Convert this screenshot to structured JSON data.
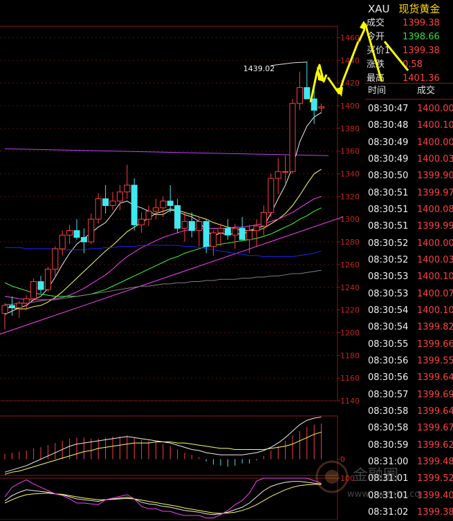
{
  "quote": {
    "symbol": "XAU",
    "name": "现货黄金",
    "rows": [
      {
        "label": "成交",
        "value": "1399.38",
        "color": "#ff4040"
      },
      {
        "label": "今开",
        "value": "1398.66",
        "color": "#30e030"
      },
      {
        "label": "买价1",
        "value": "1399.38",
        "color": "#ff4040"
      },
      {
        "label": "涨跌",
        "value": "0.58",
        "color": "#ff4040"
      },
      {
        "label": "最高",
        "value": "1401.36",
        "color": "#ff4040"
      }
    ]
  },
  "ticks": {
    "header_time": "时间",
    "header_price": "成交",
    "rows": [
      {
        "time": "08:30:47",
        "price": "1400.00"
      },
      {
        "time": "08:30:48",
        "price": "1400.10"
      },
      {
        "time": "08:30:49",
        "price": "1400.00"
      },
      {
        "time": "08:30:49",
        "price": "1400.03"
      },
      {
        "time": "08:30:50",
        "price": "1399.90"
      },
      {
        "time": "08:30:51",
        "price": "1399.97"
      },
      {
        "time": "08:30:51",
        "price": "1400.08"
      },
      {
        "time": "08:30:51",
        "price": "1399.99"
      },
      {
        "time": "08:30:52",
        "price": "1400.00"
      },
      {
        "time": "08:30:52",
        "price": "1400.03"
      },
      {
        "time": "08:30:53",
        "price": "1400.10"
      },
      {
        "time": "08:30:53",
        "price": "1400.07"
      },
      {
        "time": "08:30:54",
        "price": "1400.10"
      },
      {
        "time": "08:30:54",
        "price": "1399.82"
      },
      {
        "time": "08:30:55",
        "price": "1399.66"
      },
      {
        "time": "08:30:56",
        "price": "1399.55"
      },
      {
        "time": "08:30:56",
        "price": "1399.64"
      },
      {
        "time": "08:30:57",
        "price": "1399.69"
      },
      {
        "time": "08:30:58",
        "price": "1399.64"
      },
      {
        "time": "08:30:58",
        "price": "1399.67"
      },
      {
        "time": "08:30:59",
        "price": "1399.62"
      },
      {
        "time": "08:31:00",
        "price": "1399.48"
      },
      {
        "time": "08:31:01",
        "price": "1399.52"
      },
      {
        "time": "08:31:01",
        "price": "1399.40"
      },
      {
        "time": "08:31:02",
        "price": "1399.38"
      }
    ]
  },
  "watermark": {
    "text": "金融圈",
    "url": "www.jrwenku.com"
  },
  "chart_data": [
    {
      "type": "candlestick",
      "ylim": [
        1140,
        1470
      ],
      "yticks": [
        1140,
        1160,
        1180,
        1200,
        1220,
        1240,
        1260,
        1280,
        1300,
        1320,
        1340,
        1360,
        1380,
        1400,
        1420,
        1440,
        1460
      ],
      "annotation": "1439.02",
      "up_color": "#ff4040",
      "down_color": "#40e8f0",
      "candles": [
        [
          1217,
          1226,
          1203,
          1224
        ],
        [
          1224,
          1232,
          1215,
          1222
        ],
        [
          1222,
          1228,
          1213,
          1226
        ],
        [
          1226,
          1233,
          1220,
          1230
        ],
        [
          1230,
          1248,
          1228,
          1245
        ],
        [
          1245,
          1250,
          1235,
          1238
        ],
        [
          1238,
          1258,
          1236,
          1256
        ],
        [
          1256,
          1276,
          1250,
          1274
        ],
        [
          1274,
          1290,
          1268,
          1286
        ],
        [
          1286,
          1295,
          1278,
          1290
        ],
        [
          1290,
          1300,
          1282,
          1284
        ],
        [
          1284,
          1292,
          1270,
          1280
        ],
        [
          1280,
          1305,
          1278,
          1300
        ],
        [
          1300,
          1323,
          1296,
          1318
        ],
        [
          1318,
          1330,
          1305,
          1312
        ],
        [
          1312,
          1324,
          1308,
          1316
        ],
        [
          1316,
          1330,
          1308,
          1324
        ],
        [
          1324,
          1348,
          1318,
          1330
        ],
        [
          1330,
          1336,
          1290,
          1295
        ],
        [
          1295,
          1306,
          1288,
          1300
        ],
        [
          1300,
          1312,
          1294,
          1307
        ],
        [
          1307,
          1318,
          1300,
          1310
        ],
        [
          1310,
          1320,
          1302,
          1316
        ],
        [
          1316,
          1330,
          1306,
          1312
        ],
        [
          1312,
          1318,
          1288,
          1292
        ],
        [
          1292,
          1306,
          1280,
          1298
        ],
        [
          1298,
          1306,
          1284,
          1290
        ],
        [
          1290,
          1302,
          1276,
          1298
        ],
        [
          1298,
          1300,
          1270,
          1276
        ],
        [
          1276,
          1290,
          1268,
          1288
        ],
        [
          1288,
          1296,
          1276,
          1292
        ],
        [
          1292,
          1300,
          1282,
          1286
        ],
        [
          1286,
          1296,
          1274,
          1292
        ],
        [
          1292,
          1302,
          1282,
          1282
        ],
        [
          1282,
          1295,
          1270,
          1290
        ],
        [
          1290,
          1300,
          1276,
          1294
        ],
        [
          1294,
          1312,
          1286,
          1306
        ],
        [
          1306,
          1340,
          1302,
          1336
        ],
        [
          1336,
          1354,
          1322,
          1342
        ],
        [
          1342,
          1356,
          1332,
          1342
        ],
        [
          1342,
          1406,
          1340,
          1402
        ],
        [
          1402,
          1430,
          1396,
          1416
        ],
        [
          1416,
          1439,
          1406,
          1406
        ],
        [
          1406,
          1416,
          1384,
          1396
        ],
        [
          1398,
          1402,
          1393,
          1399
        ]
      ],
      "series": [
        {
          "name": "MA5",
          "color": "#f0f0f0",
          "values": [
            1216,
            1219,
            1222,
            1224,
            1229,
            1232,
            1239,
            1249,
            1260,
            1270,
            1278,
            1283,
            1288,
            1293,
            1297,
            1305,
            1314,
            1316,
            1312,
            1310,
            1307,
            1304,
            1304,
            1308,
            1307,
            1304,
            1302,
            1298,
            1290,
            1285,
            1288,
            1286,
            1288,
            1286,
            1290,
            1292,
            1294,
            1305,
            1318,
            1330,
            1346,
            1368,
            1382,
            1390,
            1394
          ]
        },
        {
          "name": "MA10",
          "color": "#ffff60",
          "values": [
            1222,
            1222,
            1221,
            1221,
            1223,
            1224,
            1227,
            1231,
            1236,
            1242,
            1248,
            1254,
            1260,
            1266,
            1272,
            1277,
            1283,
            1289,
            1293,
            1297,
            1301,
            1305,
            1307,
            1309,
            1308,
            1306,
            1304,
            1302,
            1300,
            1297,
            1295,
            1293,
            1292,
            1290,
            1290,
            1290,
            1292,
            1296,
            1300,
            1305,
            1312,
            1321,
            1331,
            1340,
            1344
          ]
        },
        {
          "name": "MA20",
          "color": "#ff40ff",
          "values": [
            1232,
            1231,
            1230,
            1229,
            1229,
            1229,
            1229,
            1230,
            1231,
            1233,
            1236,
            1239,
            1243,
            1247,
            1251,
            1256,
            1262,
            1267,
            1271,
            1275,
            1278,
            1281,
            1284,
            1286,
            1288,
            1290,
            1291,
            1292,
            1292,
            1292,
            1292,
            1292,
            1293,
            1293,
            1294,
            1295,
            1296,
            1298,
            1300,
            1303,
            1306,
            1310,
            1314,
            1318,
            1320
          ]
        },
        {
          "name": "MA30",
          "color": "#40ff40",
          "values": [
            1244,
            1241,
            1239,
            1237,
            1235,
            1234,
            1233,
            1232,
            1232,
            1232,
            1232,
            1233,
            1234,
            1236,
            1238,
            1241,
            1244,
            1247,
            1250,
            1253,
            1256,
            1259,
            1262,
            1265,
            1267,
            1270,
            1272,
            1274,
            1276,
            1277,
            1278,
            1279,
            1280,
            1281,
            1282,
            1283,
            1285,
            1287,
            1290,
            1293,
            1296,
            1300,
            1303,
            1307,
            1310
          ]
        },
        {
          "name": "MA60",
          "color": "#2020ff",
          "values": [
            1275,
            1275,
            1275,
            1274,
            1274,
            1274,
            1274,
            1274,
            1273,
            1273,
            1273,
            1273,
            1274,
            1274,
            1275,
            1275,
            1276,
            1276,
            1276,
            1277,
            1277,
            1277,
            1277,
            1277,
            1277,
            1276,
            1276,
            1275,
            1274,
            1273,
            1272,
            1271,
            1270,
            1269,
            1268,
            1268,
            1267,
            1267,
            1267,
            1267,
            1267,
            1268,
            1269,
            1270,
            1272
          ]
        },
        {
          "name": "MA120",
          "color": "#808080",
          "values": [
            1225,
            1225,
            1226,
            1226,
            1227,
            1228,
            1229,
            1229,
            1230,
            1231,
            1232,
            1233,
            1234,
            1235,
            1236,
            1237,
            1238,
            1239,
            1240,
            1241,
            1241,
            1242,
            1243,
            1243,
            1244,
            1244,
            1245,
            1245,
            1246,
            1246,
            1247,
            1247,
            1247,
            1248,
            1248,
            1249,
            1249,
            1250,
            1250,
            1251,
            1252,
            1252,
            1253,
            1254,
            1255
          ]
        }
      ],
      "levels": [
        {
          "name": "horizontal-line",
          "color": "#c040ff",
          "x_from": 0,
          "x_to": 45,
          "y_from": 1362,
          "y_to": 1356
        },
        {
          "name": "trend-line",
          "color": "#ff40ff",
          "x_from": -1,
          "x_to": 47,
          "y_from": 1198,
          "y_to": 1302
        }
      ]
    },
    {
      "type": "bar",
      "ylim": [
        -15,
        40
      ],
      "yticks": [
        0
      ],
      "values": [
        5,
        6,
        7,
        8,
        10,
        11,
        13,
        15,
        17,
        19,
        20,
        20,
        19,
        19,
        20,
        21,
        21,
        22,
        20,
        18,
        17,
        16,
        14,
        12,
        9,
        6,
        4,
        2,
        -2,
        -5,
        -6,
        -7,
        -6,
        -4,
        -4,
        -1,
        3,
        8,
        12,
        17,
        22,
        26,
        30,
        32,
        33
      ],
      "series": [
        {
          "name": "DIF",
          "color": "#f0f0f0",
          "values": [
            -12,
            -10,
            -8,
            -6,
            -3,
            0,
            3,
            6,
            9,
            12,
            14,
            15,
            16,
            17,
            18,
            19,
            20,
            21,
            20,
            19,
            18,
            17,
            16,
            15,
            13,
            11,
            9,
            8,
            6,
            5,
            4,
            4,
            4,
            4,
            5,
            6,
            8,
            11,
            15,
            20,
            26,
            32,
            36,
            38,
            39
          ]
        },
        {
          "name": "DEA",
          "color": "#ffff60",
          "values": [
            -14,
            -12,
            -11,
            -9,
            -7,
            -5,
            -3,
            -1,
            1,
            3,
            5,
            7,
            8,
            10,
            11,
            12,
            13,
            14,
            15,
            15,
            15,
            16,
            16,
            16,
            15,
            15,
            14,
            13,
            12,
            11,
            10,
            10,
            9,
            9,
            9,
            9,
            9,
            10,
            11,
            12,
            14,
            17,
            20,
            23,
            25
          ]
        }
      ]
    },
    {
      "type": "line",
      "ylim": [
        0,
        100
      ],
      "yticks": [
        100
      ],
      "series": [
        {
          "name": "K",
          "color": "#f0f0f0",
          "values": [
            45,
            58,
            66,
            72,
            70,
            68,
            66,
            62,
            60,
            55,
            50,
            48,
            46,
            44,
            48,
            50,
            52,
            54,
            50,
            42,
            38,
            36,
            32,
            30,
            26,
            22,
            20,
            18,
            14,
            12,
            14,
            18,
            24,
            30,
            40,
            55,
            70,
            80,
            86,
            90,
            92,
            92,
            90,
            88,
            86
          ]
        },
        {
          "name": "D",
          "color": "#ffff60",
          "values": [
            40,
            48,
            55,
            60,
            62,
            63,
            64,
            62,
            61,
            58,
            55,
            52,
            50,
            48,
            48,
            49,
            50,
            51,
            50,
            47,
            44,
            41,
            38,
            35,
            32,
            28,
            25,
            22,
            19,
            16,
            15,
            16,
            18,
            22,
            28,
            36,
            46,
            56,
            64,
            72,
            78,
            82,
            84,
            85,
            85
          ]
        },
        {
          "name": "J",
          "color": "#ff40ff",
          "values": [
            55,
            78,
            88,
            96,
            86,
            78,
            70,
            62,
            58,
            50,
            40,
            40,
            38,
            36,
            48,
            52,
            56,
            60,
            50,
            32,
            26,
            26,
            20,
            20,
            14,
            10,
            10,
            10,
            4,
            4,
            12,
            22,
            36,
            46,
            64,
            93,
            100,
            100,
            100,
            100,
            100,
            100,
            100,
            94,
            88
          ]
        }
      ]
    }
  ]
}
